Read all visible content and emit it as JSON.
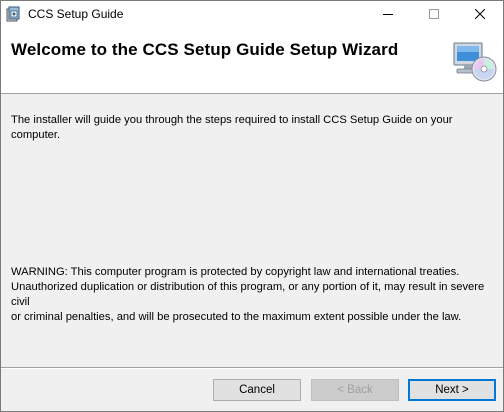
{
  "window": {
    "title": "CCS Setup Guide",
    "controls": [
      "minimize-icon",
      "maximize-icon",
      "close-icon"
    ]
  },
  "banner": {
    "title": "Welcome to the CCS Setup Guide Setup Wizard",
    "icon": "computer-cd-icon"
  },
  "content": {
    "intro": "The installer will guide you through the steps required to install CCS Setup Guide on your computer.",
    "warning": "WARNING: This computer program is protected by copyright law and international treaties.\nUnauthorized duplication or distribution of this program, or any portion of it, may result in severe civil\nor criminal penalties, and will be prosecuted to the maximum extent possible under the law."
  },
  "buttons": {
    "cancel": "Cancel",
    "back": "< Back",
    "next": "Next >"
  },
  "colors": {
    "accent": "#0078d7",
    "disabled_text": "#a0a0a0"
  }
}
